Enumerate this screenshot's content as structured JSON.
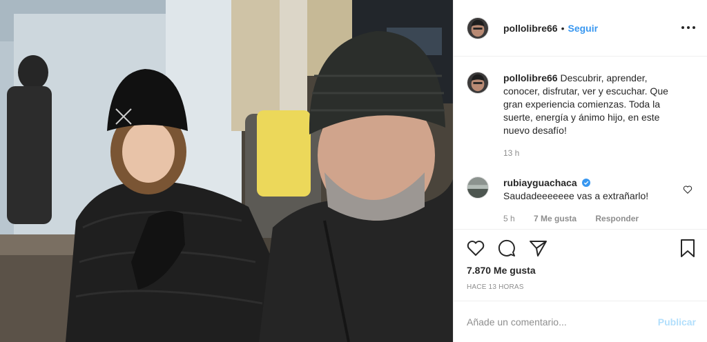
{
  "post": {
    "username": "pollolibre66",
    "dot": "•",
    "follow_label": "Seguir",
    "more_icon": "more-horizontal-icon"
  },
  "caption": {
    "username": "pollolibre66",
    "text": "Descubrir, aprender, conocer, disfrutar, ver y escuchar. Que gran experiencia comienzas. Toda la suerte, energía y ánimo hijo, en este nuevo desafío!",
    "time": "13 h"
  },
  "comments": [
    {
      "username": "rubiayguachaca",
      "verified": true,
      "text": "Saudadeeeeeee vas a extrañarlo!",
      "time": "5 h",
      "likes": "7 Me gusta",
      "reply_label": "Responder"
    }
  ],
  "actions": {
    "likes": "7.870 Me gusta",
    "time_ago": "HACE 13 HORAS",
    "icons": [
      "heart-icon",
      "comment-icon",
      "share-icon",
      "bookmark-icon"
    ]
  },
  "add_comment": {
    "placeholder": "Añade un comentario...",
    "publish_label": "Publicar"
  },
  "colors": {
    "link": "#3897f0",
    "publish_disabled": "#b2dffc",
    "text": "#262626",
    "secondary": "#8e8e8e",
    "border": "#efefef"
  }
}
